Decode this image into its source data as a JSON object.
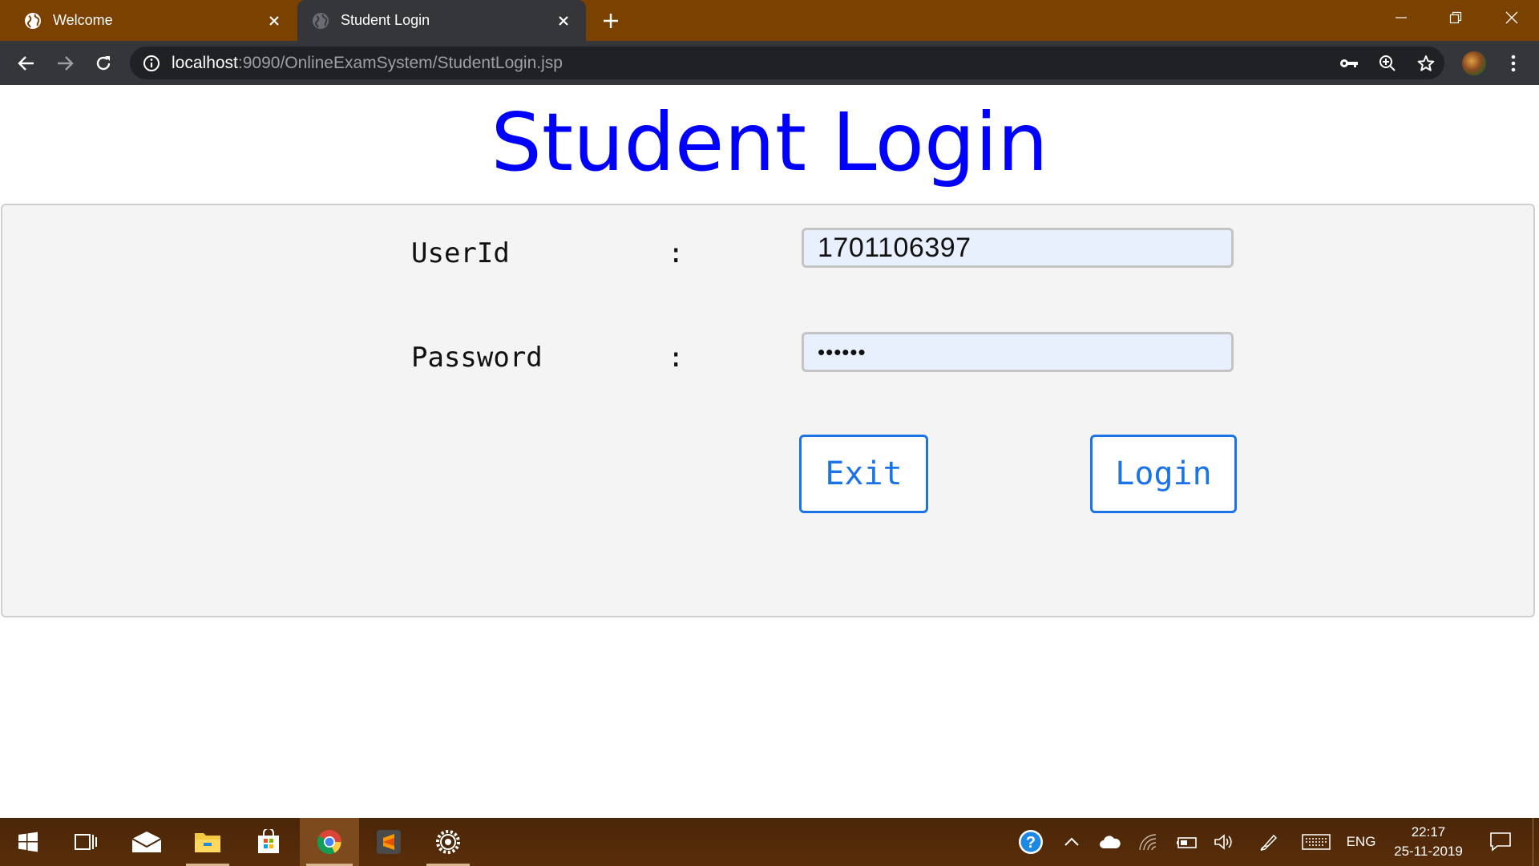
{
  "browser": {
    "tabs": [
      {
        "title": "Welcome",
        "active": false
      },
      {
        "title": "Student Login",
        "active": true
      }
    ],
    "address": {
      "host": "localhost",
      "path": ":9090/OnlineExamSystem/StudentLogin.jsp"
    }
  },
  "page": {
    "title": "Student Login",
    "form": {
      "userid_label": "UserId",
      "password_label": "Password",
      "colon": ":",
      "userid_value": "1701106397",
      "password_mask": "••••••",
      "exit_label": "Exit",
      "login_label": "Login"
    }
  },
  "taskbar": {
    "language": "ENG",
    "time": "22:17",
    "date": "25-11-2019",
    "apps": [
      "start-icon",
      "task-view-icon",
      "mail-icon",
      "file-explorer-icon",
      "store-icon",
      "chrome-icon",
      "sublime-icon",
      "settings-gear-icon"
    ]
  },
  "colors": {
    "title_blue": "#0000ff",
    "button_blue": "#1a73e8",
    "tabbar_brown": "#7a4100",
    "autofill_bg": "#e8f0fe"
  }
}
